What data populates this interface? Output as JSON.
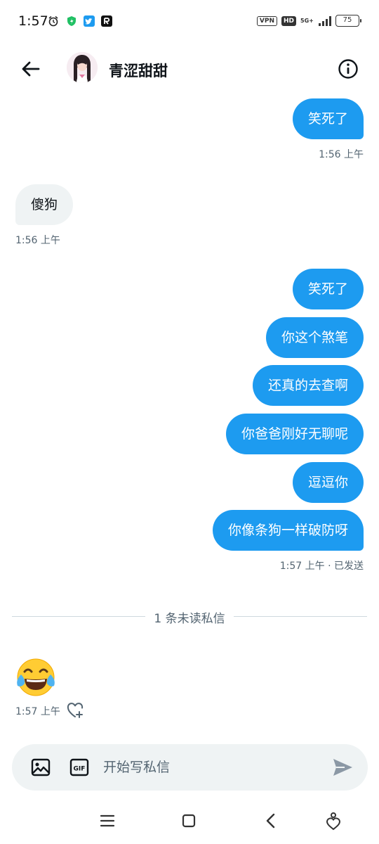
{
  "status_bar": {
    "time": "1:57",
    "vpn": "VPN",
    "hd": "HD",
    "network": "5G+",
    "battery": "75"
  },
  "header": {
    "contact_name": "青涩甜甜"
  },
  "messages": [
    {
      "dir": "out",
      "text": "笑死了"
    },
    {
      "meta": "1:56 上午"
    },
    {
      "dir": "in",
      "text": "傻狗"
    },
    {
      "meta": "1:56 上午"
    },
    {
      "dir": "out",
      "text": "笑死了"
    },
    {
      "dir": "out",
      "text": "你这个煞笔"
    },
    {
      "dir": "out",
      "text": "还真的去查啊"
    },
    {
      "dir": "out",
      "text": "你爸爸刚好无聊呢"
    },
    {
      "dir": "out",
      "text": "逗逗你"
    },
    {
      "dir": "out",
      "text": "你像条狗一样破防呀"
    },
    {
      "meta": "1:57 上午 · 已发送"
    }
  ],
  "conversation": {
    "m1": "笑死了",
    "m1_meta": "1:56 上午",
    "m2": "傻狗",
    "m2_meta": "1:56 上午",
    "m3": "笑死了",
    "m4": "你这个煞笔",
    "m5": "还真的去查啊",
    "m6": "你爸爸刚好无聊呢",
    "m7": "逗逗你",
    "m8": "你像条狗一样破防呀",
    "m8_meta": "1:57 上午 · 已发送",
    "unread_divider": "1 条未读私信",
    "last_emoji": "😂",
    "last_meta": "1:57 上午"
  },
  "composer": {
    "placeholder": "开始写私信",
    "gif_label": "GIF"
  },
  "colors": {
    "accent": "#1d9bf0",
    "incoming_bubble": "#eff3f4",
    "meta_text": "#536471"
  },
  "icons": [
    "back-arrow-icon",
    "info-icon",
    "image-icon",
    "gif-icon",
    "send-icon",
    "heart-plus-icon",
    "menu-icon",
    "home-square-icon",
    "back-chevron-icon",
    "assistant-icon"
  ]
}
